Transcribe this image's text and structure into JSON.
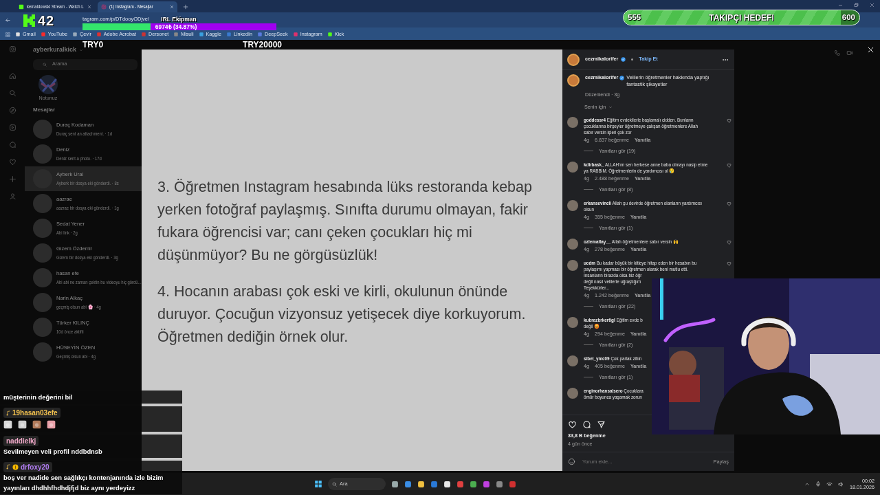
{
  "browser": {
    "tabs": [
      {
        "title": "kemaldowski Stream - Watch L",
        "selected": false
      },
      {
        "title": "(1) Instagram - Mesajlar",
        "selected": true
      }
    ],
    "address": "tagram.com/p/DTdooyODjve/",
    "bookmarks": [
      "Gmail",
      "YouTube",
      "Çevir",
      "Adobe Acrobat",
      "Dersonet",
      "Misuli",
      "Kaggle",
      "LinkedIn",
      "DeepSeek",
      "Instagram",
      "Kick"
    ]
  },
  "sidebar": {
    "username": "ayberkuralkick",
    "search_placeholder": "Arama",
    "note_label": "Notunuz",
    "section_title": "Mesajlar",
    "conversations": [
      {
        "name": "Duraç Kodaman",
        "preview": "Duraç sent an attachment. · 1d",
        "selected": false
      },
      {
        "name": "Deniz",
        "preview": "Deniz sent a photo. · 17d",
        "selected": false
      },
      {
        "name": "Ayberk Ural",
        "preview": "Ayberk bir dosya eki gönderdi. · 8s",
        "selected": true
      },
      {
        "name": "aazrae",
        "preview": "aazrae bir dosya eki gönderdi. · 1g",
        "selected": false
      },
      {
        "name": "Sedat Yener",
        "preview": "Abi link · 2g",
        "selected": false
      },
      {
        "name": "Gizem Özdemir",
        "preview": "Gizem bir dosya eki gönderdi. · 3g",
        "selected": false
      },
      {
        "name": "hasan efe",
        "preview": "Abi abi ne zaman çektin bu videoyu hiç gördü...",
        "selected": false
      },
      {
        "name": "Narin Alkaç",
        "preview": "geçmiş olsun abi 🌸 · 4g",
        "selected": false
      },
      {
        "name": "Türker KILINÇ",
        "preview": "10d önce aktifti",
        "selected": false
      },
      {
        "name": "HÜSEYİN ÖZEN",
        "preview": "Geçmiş olsun abi · 4g",
        "selected": false
      }
    ]
  },
  "post": {
    "paragraphs": [
      "3. Öğretmen Instagram hesabında lüks restoranda kebap yerken fotoğraf paylaşmış. Sınıfta durumu olmayan, fakir fukara öğrencisi var; canı çeken çocukları hiç mi düşünmüyor? Bu ne görgüsüzlük!",
      "4. Hocanın arabası çok eski ve kirli, okulunun önünde duruyor. Çocuğun vizyonsuz yetişecek diye korkuyorum. Öğretmen dediğin örnek olur."
    ]
  },
  "panel": {
    "author": "cezmikalorifer",
    "verified": true,
    "follow": "Takip Et",
    "caption": {
      "author": "cezmikalorifer",
      "text": "Velilerin öğretmenler hakkında yaptığı fantastik şikayetler",
      "meta": "Düzenlendi · 3g"
    },
    "sort": "Senin için",
    "comments": [
      {
        "user": "goddessr4",
        "lines": [
          "Eğitim evdekilerle başlamalı cidden. Bunların",
          "çocuklarına birşeyler öğretmeye çalışan öğretmenlere Allah",
          "sabır versin işleri çok zor"
        ],
        "time": "4g",
        "likes": "6.837 beğenme",
        "reply": "Yanıtla",
        "replies": "Yanıtları gör (19)",
        "like_icon": true
      },
      {
        "user": "kdirbask_",
        "lines": [
          "ALLAH'ım sen herkese anne baba olmayı nasip etme",
          "ya RABBİM. Öğretmenlerin de yardımcısı ol 😢"
        ],
        "time": "4g",
        "likes": "2.488 beğenme",
        "reply": "Yanıtla",
        "replies": "Yanıtları gör (8)",
        "like_icon": true
      },
      {
        "user": "erkansevincli",
        "lines": [
          "Allah şu devirde öğretmen olanların yardımcısı",
          "olsun"
        ],
        "time": "4g",
        "likes": "355 beğenme",
        "reply": "Yanıtla",
        "replies": "Yanıtları gör (1)",
        "like_icon": true
      },
      {
        "user": "ozlemaltay__",
        "lines": [
          "Allah öğretmenlere sabır versin 🙌"
        ],
        "time": "4g",
        "likes": "278 beğenme",
        "reply": "Yanıtla",
        "like_icon": true
      },
      {
        "user": "ucdm",
        "lines": [
          "Bu kadar büyük bir kitleye hitap eden bir hesabın bu",
          "paylaşımı yapması bir öğretmen olarak beni mutlu etti.",
          "İnsanların birazda olsa biz öğr",
          "değil nasıl velilerle uğraştığım",
          "Teşekkürler..."
        ],
        "time": "4g",
        "likes": "1.242 beğenme",
        "reply": "Yanıtla",
        "replies": "Yanıtları gör (22)",
        "like_icon": true
      },
      {
        "user": "kubrazbrkcrtigl",
        "lines": [
          "Eğitim evde b",
          "değil 😡"
        ],
        "time": "4g",
        "likes": "294 beğenme",
        "reply": "Yanıtla",
        "replies": "Yanıtları gör (2)",
        "like_icon": false
      },
      {
        "user": "sibel_ymc09",
        "lines": [
          "Çok parlak zihin"
        ],
        "time": "4g",
        "likes": "405 beğenme",
        "reply": "Yanıtla",
        "replies": "Yanıtları gör (1)",
        "like_icon": false
      },
      {
        "user": "enginorhansalsero",
        "lines": [
          "Çocuklara",
          "ömür boyunca yaşamak zorun"
        ],
        "like_icon": false
      }
    ],
    "likes": "33,8 B beğenme",
    "date": "4 gün önce",
    "comment_placeholder": "Yorum ekle...",
    "post_button": "Paylaş"
  },
  "overlay": {
    "channel_number": "42",
    "donation_goal": {
      "title": "IRL Ekipman",
      "amount": "6974₺ (34.87%)",
      "level": 0.35,
      "min": "TRY0",
      "max": "TRY20000"
    },
    "follower_goal": {
      "current": "555",
      "title": "TAKIPÇI HEDEFI",
      "target": "600",
      "level": 0.92
    },
    "chat": [
      {
        "text": "müşterinin değerini bil"
      },
      {
        "user": "19hasan03efe",
        "color": "#f2c14e",
        "badges": [
          {
            "kind": "note"
          }
        ],
        "emotes": [
          {
            "color": "#d9d9d9"
          },
          {
            "color": "#cfcfcf"
          },
          {
            "color": "#b07a5a"
          },
          {
            "color": "#e8a0a8"
          }
        ]
      },
      {
        "user": "naddielkj",
        "color": "#f0a8c8",
        "text": "Sevilmeyen veli profil nddbdnsb"
      },
      {
        "user": "drfoxy20",
        "color": "#b07cf0",
        "badges": [
          {
            "kind": "note"
          },
          {
            "kind": "coin"
          }
        ],
        "text": "boş ver nadide sen sağlıkçı kontenjanında izle bizim yayınları dhdhhfhdhdjfjd biz aynı yerdeyizz"
      }
    ]
  },
  "taskbar": {
    "search": "Ara",
    "time": "00:02",
    "date": "18.01.2026"
  }
}
